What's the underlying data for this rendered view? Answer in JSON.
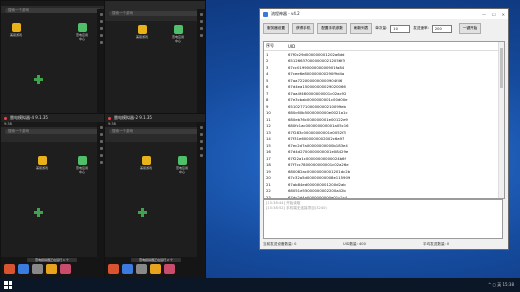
{
  "emulators": [
    {
      "search": "搜索一个游戏",
      "apps": [
        "美丽游戏",
        "雷电应用中心"
      ],
      "cross": "加速"
    },
    {
      "title": "雷电模拟器-4 9.1.35",
      "status": "9:38",
      "search": "搜索一个游戏",
      "apps": [
        "美丽游戏",
        "雷电应用中心"
      ],
      "cross": "加速",
      "toast": "雷电模拟器正在运行 1 个",
      "dock": [
        "雷电市场",
        "安卓商店",
        "设置",
        "浏览器",
        "相册"
      ]
    },
    {
      "title": "雷电模拟器-3 9.1.35",
      "status": "9:38",
      "search": "搜索一个游戏",
      "apps": [
        "美丽游戏",
        "雷电应用中心"
      ],
      "cross": "加速"
    },
    {
      "title": "雷电模拟器-2 9.1.35",
      "status": "9:38",
      "search": "搜索一个游戏",
      "apps": [
        "美丽游戏",
        "雷电应用中心"
      ],
      "cross": "加速",
      "toast": "雷电模拟器正在运行 2 个",
      "dock": [
        "雷电市场",
        "安卓商店",
        "设置",
        "浏览器",
        "相册"
      ]
    }
  ],
  "tool": {
    "title": "流程神器 - v4.2",
    "buttons": [
      "服务器设置",
      "获得手机",
      "配置手机参数",
      "刷新列表"
    ],
    "threads_label": "单次量:",
    "threads_value": "10",
    "send_label": "发送速率:",
    "send_value": "200",
    "run_button": "一键开始",
    "columns": [
      "序号",
      "UID"
    ],
    "rows": [
      [
        "1",
        "67f0c29d000000001202a6dd"
      ],
      [
        "2",
        "6512663700000000212056f3"
      ],
      [
        "3",
        "67cc0199000000000901fa84"
      ],
      [
        "4",
        "67cee6e800000000290f9d4a"
      ],
      [
        "5",
        "67aa7220000000000904f46"
      ],
      [
        "6",
        "67d4ea150000000029020066"
      ],
      [
        "7",
        "67aa4f460000000001c02ac92"
      ],
      [
        "8",
        "67e3cbab0000000001c00d00e"
      ],
      [
        "9",
        "6510277100000000210099eb"
      ],
      [
        "10",
        "680c60b5000000000e0021a1c"
      ],
      [
        "11",
        "680eb76c000000001e00122e9"
      ],
      [
        "12",
        "680fc1ac000000000001a05c16"
      ],
      [
        "13",
        "67f283c00000000001e0052f3"
      ],
      [
        "14",
        "67f31e6000000002002c6a97"
      ],
      [
        "15",
        "67ec2d7a00000000000b183e4"
      ],
      [
        "16",
        "67d4d2700000000001e08429e"
      ],
      [
        "17",
        "67f22a1c00000000000024b6f"
      ],
      [
        "18",
        "67f7cc7800000000001c02a26e"
      ],
      [
        "19",
        "680082ac00000000001201dc2b"
      ],
      [
        "20",
        "67c32a5d00000000008e115909"
      ],
      [
        "21",
        "67ab84ed000000001200d2ab"
      ],
      [
        "22",
        "68051e55000000002200a42b"
      ],
      [
        "23",
        "67dc2d4a0000000000e01c2c4"
      ]
    ],
    "log_lines": [
      "[15:38:44] 开始读取",
      "[15:38:52] 手机端无连接项目(3240)"
    ],
    "status_left": "当前发送设备数量: 0",
    "status_mid": "UID数量: 400",
    "status_right": "平均发送数量: 0"
  },
  "taskbar": {
    "tray": "^  ◻  英  15:38"
  }
}
